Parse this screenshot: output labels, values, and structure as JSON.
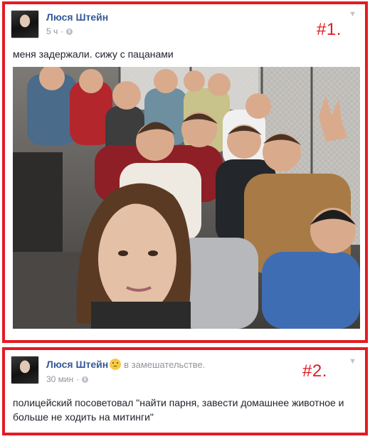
{
  "post1": {
    "author": "Люся Штейн",
    "time": "5 ч",
    "separator": "·",
    "label": "#1.",
    "text": "меня задержали. сижу с пацанами"
  },
  "post2": {
    "author": "Люся Штейн",
    "status": "в замешательстве.",
    "time": "30 мин",
    "separator": "·",
    "label": "#2.",
    "text": "полицейский посоветовал \"найти парня, завести домашнее животное и больше не ходить на митинги\""
  },
  "icons": {
    "privacy": "globe-icon",
    "menu": "chevron-down-icon",
    "feeling": "confused-face-icon"
  },
  "colors": {
    "highlight_border": "#e31b23",
    "author_link": "#365899",
    "meta_gray": "#90949c"
  }
}
